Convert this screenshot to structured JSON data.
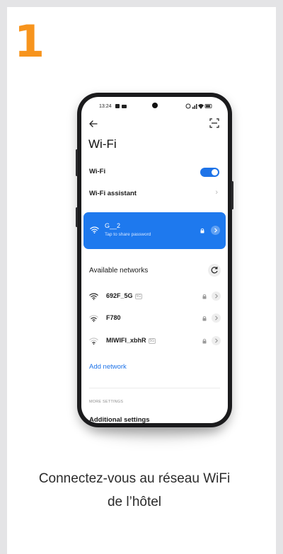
{
  "step_number": "1",
  "caption": {
    "line1": "Connectez-vous au réseau WiFi",
    "line2": "de l’hôtel"
  },
  "phone": {
    "status_time": "13:24",
    "page_title": "Wi-Fi",
    "wifi_toggle": {
      "label": "Wi-Fi",
      "state": "on"
    },
    "assistant_label": "Wi-Fi assistant",
    "connected": {
      "name": "G__2",
      "subtitle": "Tap to share password"
    },
    "available_title": "Available networks",
    "networks": [
      {
        "name": "692F_5G",
        "badge": "5G",
        "locked": true
      },
      {
        "name": "F780",
        "badge": "",
        "locked": true
      },
      {
        "name": "MIWIFI_xbhR",
        "badge": "5G",
        "locked": true
      }
    ],
    "add_network": "Add network",
    "more_settings": "MORE SETTINGS"
  },
  "colors": {
    "accent_orange": "#f7941d",
    "accent_blue": "#1e79ee",
    "background": "#e4e4e6"
  }
}
